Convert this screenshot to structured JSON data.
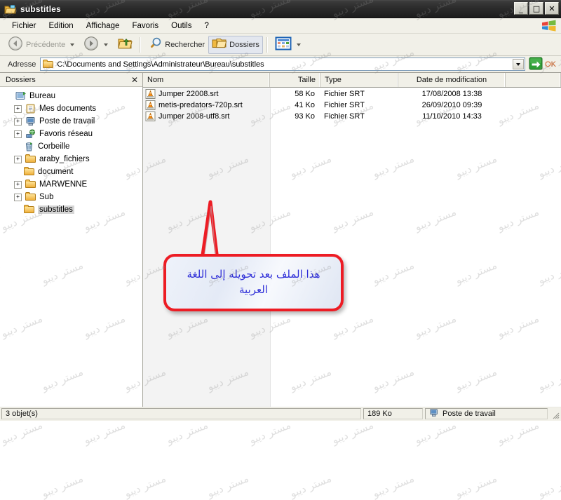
{
  "window": {
    "title": "substitles",
    "title_icon": "folder-open-icon",
    "controls": [
      {
        "name": "minimize-button",
        "glyph": "_"
      },
      {
        "name": "maximize-button",
        "glyph": "□"
      },
      {
        "name": "close-button",
        "glyph": "✕"
      }
    ]
  },
  "menu": {
    "items": [
      "Fichier",
      "Edition",
      "Affichage",
      "Favoris",
      "Outils",
      "?"
    ],
    "logo": "windows-flag-icon"
  },
  "toolbar": {
    "back_label": "Précédente",
    "back_icon": "back-arrow-icon",
    "forward_icon": "forward-arrow-icon",
    "up_icon": "up-folder-icon",
    "search_label": "Rechercher",
    "search_icon": "magnifier-icon",
    "folders_label": "Dossiers",
    "folders_icon": "folders-icon",
    "views_icon": "views-tiles-icon"
  },
  "address": {
    "label": "Adresse",
    "path": "C:\\Documents and Settings\\Administrateur\\Bureau\\substitles",
    "folder_icon": "folder-icon",
    "dropdown_icon": "chevron-down-icon",
    "go_label": "OK",
    "go_icon": "green-arrow-icon"
  },
  "folders_pane": {
    "title": "Dossiers",
    "close_glyph": "✕",
    "tree": [
      {
        "label": "Bureau",
        "icon": "desktop-icon",
        "expander": "",
        "indent": 0,
        "selected": false
      },
      {
        "label": "Mes documents",
        "icon": "documents-icon",
        "expander": "+",
        "indent": 1,
        "selected": false
      },
      {
        "label": "Poste de travail",
        "icon": "computer-icon",
        "expander": "+",
        "indent": 1,
        "selected": false
      },
      {
        "label": "Favoris réseau",
        "icon": "network-icon",
        "expander": "+",
        "indent": 1,
        "selected": false
      },
      {
        "label": "Corbeille",
        "icon": "recycle-bin-icon",
        "expander": "",
        "indent": 1,
        "selected": false
      },
      {
        "label": "araby_fichiers",
        "icon": "folder-icon",
        "expander": "+",
        "indent": 1,
        "selected": false
      },
      {
        "label": "document",
        "icon": "folder-icon",
        "expander": "",
        "indent": 1,
        "selected": false
      },
      {
        "label": "MARWENNE",
        "icon": "folder-icon",
        "expander": "+",
        "indent": 1,
        "selected": false
      },
      {
        "label": "Sub",
        "icon": "folder-icon",
        "expander": "+",
        "indent": 1,
        "selected": false
      },
      {
        "label": "substitles",
        "icon": "folder-icon",
        "expander": "",
        "indent": 1,
        "selected": true
      }
    ]
  },
  "file_list": {
    "columns": [
      "Nom",
      "Taille",
      "Type",
      "Date de modification"
    ],
    "rows": [
      {
        "name": "Jumper 22008.srt",
        "size": "58 Ko",
        "type": "Fichier SRT",
        "date": "17/08/2008 13:38",
        "icon": "vlc-cone-icon"
      },
      {
        "name": "metis-predators-720p.srt",
        "size": "41 Ko",
        "type": "Fichier SRT",
        "date": "26/09/2010 09:39",
        "icon": "vlc-cone-icon"
      },
      {
        "name": "Jumper 2008-utf8.srt",
        "size": "93 Ko",
        "type": "Fichier SRT",
        "date": "11/10/2010 14:33",
        "icon": "vlc-cone-icon"
      }
    ]
  },
  "callout": {
    "text": "هذا الملف بعد تحويله إلى اللغة العربية",
    "border_color": "#ed1c24",
    "text_color": "#2f2fd8"
  },
  "watermark": {
    "text": "مستر ديبو"
  },
  "status_bar": {
    "objects": "3 objet(s)",
    "size": "189 Ko",
    "location": "Poste de travail",
    "location_icon": "computer-icon"
  }
}
